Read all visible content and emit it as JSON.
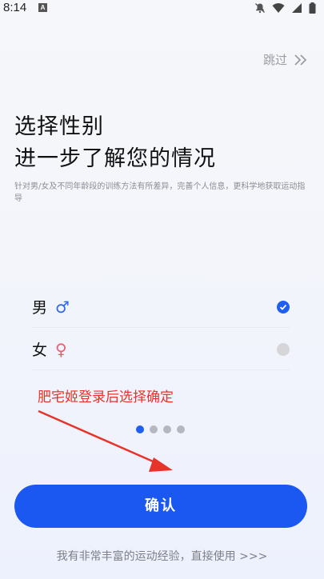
{
  "status_bar": {
    "time": "8:14",
    "a_badge": "A"
  },
  "header": {
    "skip_label": "跳过"
  },
  "intro": {
    "title_line1": "选择性别",
    "title_line2": "进一步了解您的情况",
    "subtitle": "针对男/女及不同年龄段的训练方法有所差异，完善个人信息，更科学地获取运动指导"
  },
  "gender_options": [
    {
      "label": "男",
      "symbol": "♂",
      "selected": true
    },
    {
      "label": "女",
      "symbol": "♀",
      "selected": false
    }
  ],
  "annotation": {
    "text": "肥宅姬登录后选择确定"
  },
  "pager": {
    "total": 4,
    "current": 1
  },
  "actions": {
    "confirm_label": "确认",
    "experienced_link": "我有非常丰富的运动经验，直接使用 >>>"
  },
  "colors": {
    "accent": "#1b58f2",
    "annotation_red": "#e6342a",
    "male_symbol": "#2a66f0",
    "female_symbol": "#ee5d6f"
  }
}
